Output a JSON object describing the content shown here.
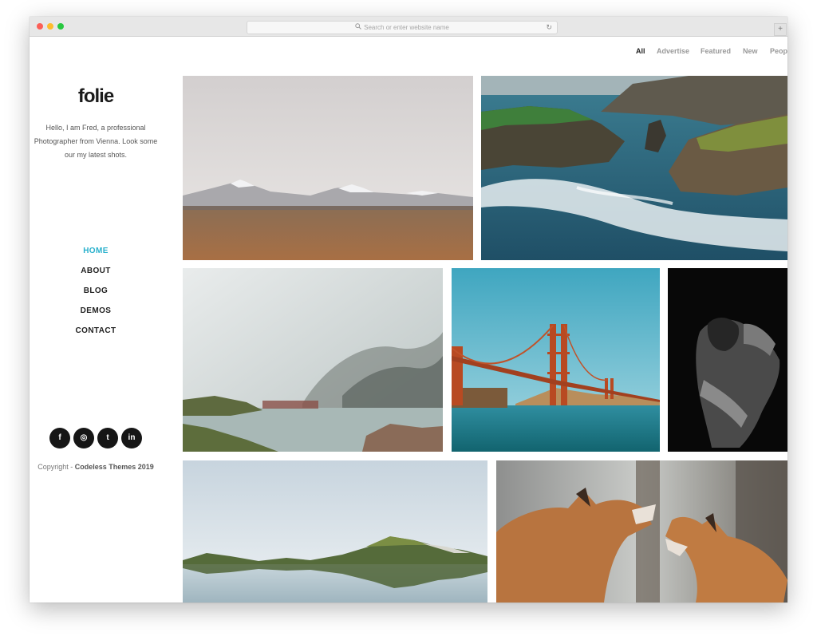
{
  "browser": {
    "url_placeholder": "Search or enter website name",
    "reload_icon": "reload-icon",
    "new_tab_label": "+"
  },
  "sidebar": {
    "logo": "folie",
    "intro": "Hello, I am Fred, a professional Photographer from Vienna. Look some our my latest shots.",
    "nav": [
      "HOME",
      "ABOUT",
      "BLOG",
      "DEMOS",
      "CONTACT"
    ],
    "active_nav": "HOME",
    "social_icons": [
      "facebook-icon",
      "instagram-icon",
      "twitter-icon",
      "linkedin-icon"
    ],
    "social_glyphs": [
      "f",
      "◎",
      "t",
      "in"
    ],
    "copyright_prefix": "Copyright - ",
    "copyright_brand": "Codeless Themes 2019"
  },
  "filters": [
    "All",
    "Advertise",
    "Featured",
    "New",
    "Peop"
  ],
  "active_filter": "All",
  "gallery": {
    "photos": [
      "desert-mountains",
      "coastal-cliffs",
      "misty-lake",
      "golden-gate-bridge",
      "portrait-bw",
      "mountain-reflection",
      "foxes"
    ]
  },
  "colors": {
    "accent": "#28b0cc",
    "text_dark": "#222222",
    "social_bg": "#161616"
  }
}
